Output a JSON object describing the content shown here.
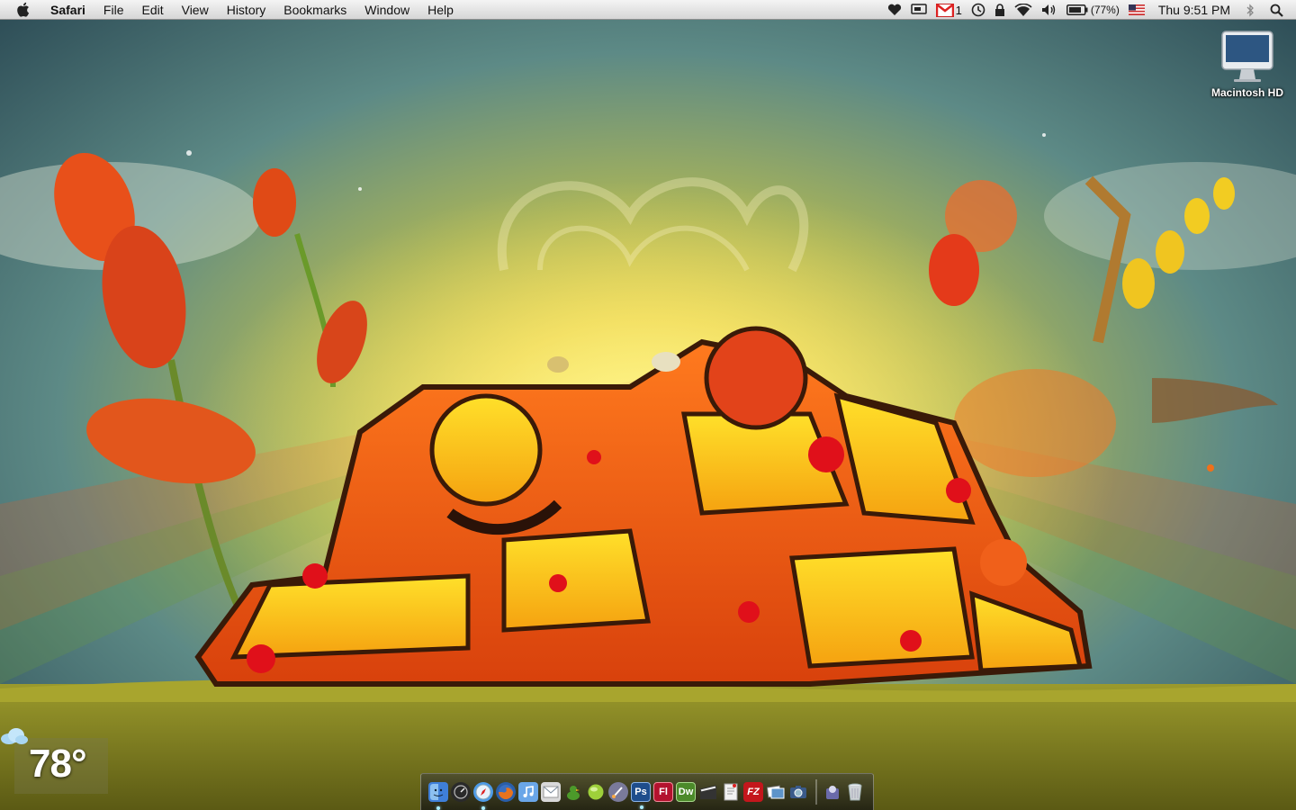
{
  "menubar": {
    "app_name": "Safari",
    "menus": [
      "File",
      "Edit",
      "View",
      "History",
      "Bookmarks",
      "Window",
      "Help"
    ],
    "status": {
      "gmail_count": "1",
      "battery": "(77%)",
      "clock": "Thu 9:51 PM"
    },
    "status_icons": [
      "heart-icon",
      "display-icon",
      "gmail-icon",
      "time-machine-icon",
      "lock-icon",
      "wifi-icon",
      "volume-icon",
      "battery-icon",
      "us-flag-icon",
      "bluetooth-icon",
      "spotlight-icon"
    ]
  },
  "desktop": {
    "icons": [
      {
        "label": "Macintosh HD",
        "icon": "imac-icon"
      }
    ]
  },
  "weather_widget": {
    "temperature": "78°",
    "icon": "cloud-icon"
  },
  "dock": {
    "apps": [
      {
        "name": "finder",
        "icon": "finder-icon",
        "color": "#3f7fd8"
      },
      {
        "name": "dashboard",
        "icon": "dashboard-icon",
        "color": "#2a2a2a"
      },
      {
        "name": "safari",
        "icon": "safari-compass-icon",
        "color": "#4c9be8"
      },
      {
        "name": "firefox",
        "icon": "firefox-icon",
        "color": "#e06a1e"
      },
      {
        "name": "itunes",
        "icon": "itunes-icon",
        "color": "#6aa6e8"
      },
      {
        "name": "mail",
        "icon": "mail-stamp-icon",
        "color": "#d9d9d9"
      },
      {
        "name": "adium",
        "icon": "duck-icon",
        "color": "#4c9a2a"
      },
      {
        "name": "lime",
        "icon": "green-orb-icon",
        "color": "#9ed03a"
      },
      {
        "name": "pixelmator",
        "icon": "brush-icon",
        "color": "#7a7a9a"
      },
      {
        "name": "photoshop",
        "label": "Ps",
        "icon": "photoshop-icon",
        "color": "#1e4d8c"
      },
      {
        "name": "flash",
        "label": "Fl",
        "icon": "flash-icon",
        "color": "#b3122e"
      },
      {
        "name": "dreamweaver",
        "label": "Dw",
        "icon": "dreamweaver-icon",
        "color": "#4c8a2a"
      },
      {
        "name": "final-cut",
        "icon": "clapper-icon",
        "color": "#333333"
      },
      {
        "name": "textedit",
        "icon": "document-icon",
        "color": "#f2f2f2"
      },
      {
        "name": "filezilla",
        "label": "FZ",
        "icon": "filezilla-icon",
        "color": "#c4161c"
      },
      {
        "name": "preview",
        "icon": "photos-icon",
        "color": "#5e94c9"
      },
      {
        "name": "iphoto",
        "icon": "camera-icon",
        "color": "#3a5a8a"
      }
    ],
    "trailing": [
      {
        "name": "applications-stack",
        "icon": "stack-icon",
        "color": "#6a6aaa"
      },
      {
        "name": "trash",
        "icon": "trash-icon",
        "color": "#cfd3d6"
      }
    ]
  }
}
